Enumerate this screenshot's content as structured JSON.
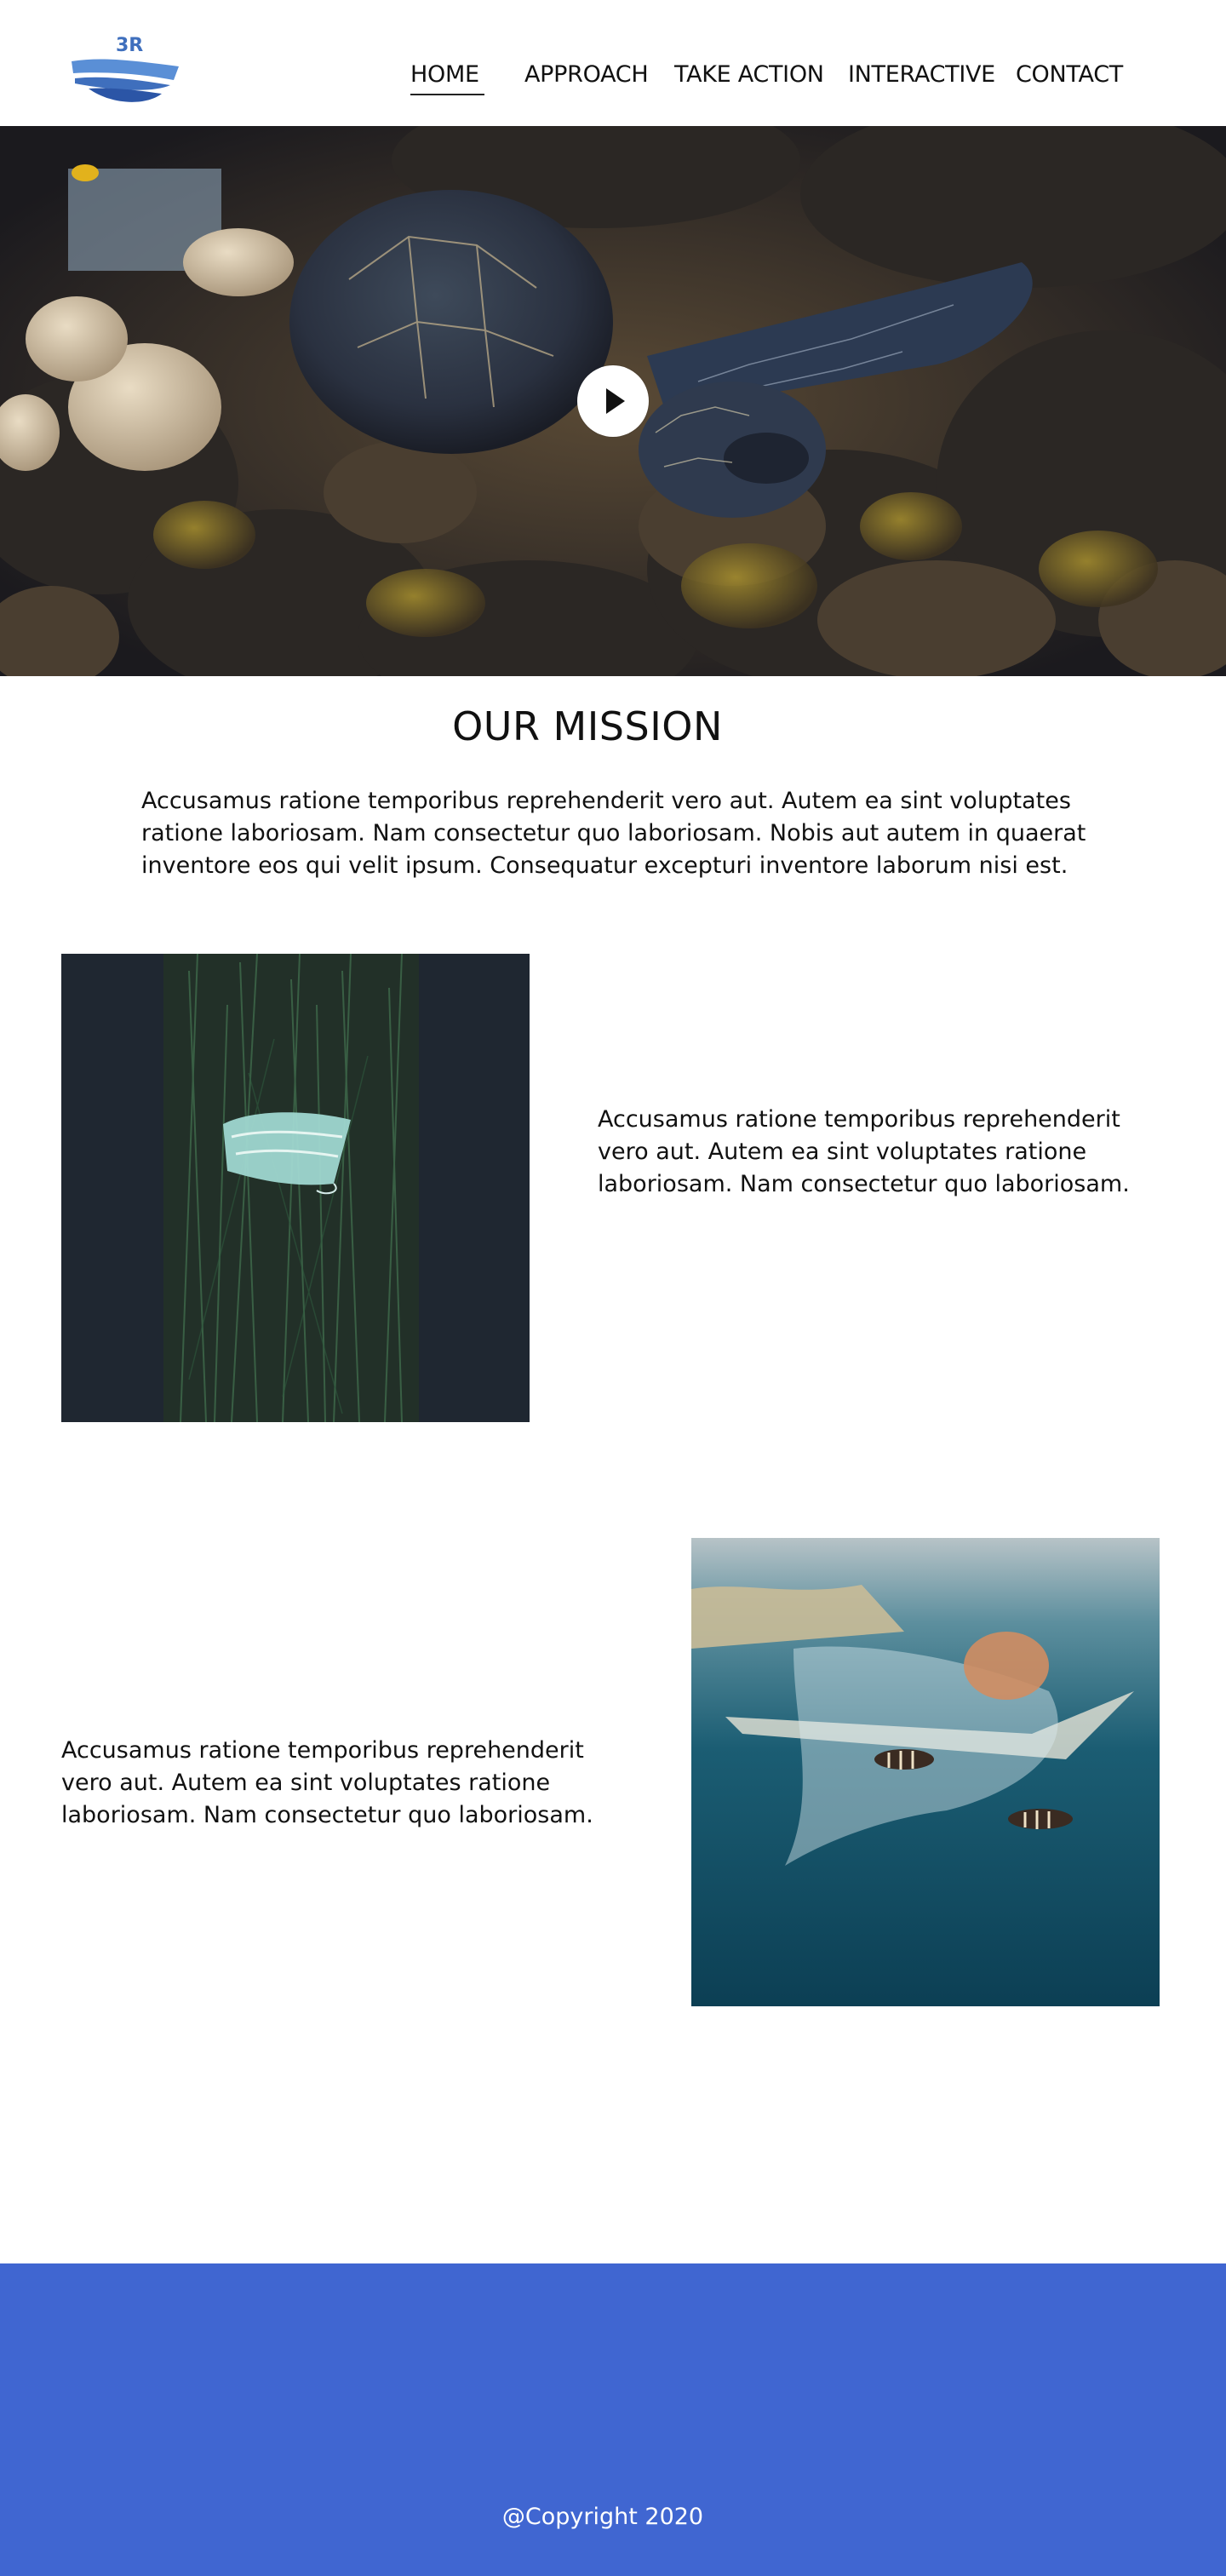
{
  "header": {
    "logo_text": "3R",
    "nav": [
      {
        "label": "HOME",
        "active": true
      },
      {
        "label": "APPROACH",
        "active": false
      },
      {
        "label": "TAKE ACTION",
        "active": false
      },
      {
        "label": "INTERACTIVE",
        "active": false
      },
      {
        "label": "CONTACT",
        "active": false
      }
    ]
  },
  "hero": {
    "image": "sea-turtle-on-reef",
    "play_icon": "play-icon"
  },
  "mission": {
    "title": "OUR MISSION",
    "text": "Accusamus ratione temporibus reprehenderit vero aut. Autem ea sint voluptates ratione laboriosam. Nam consectetur quo laboriosam. Nobis aut autem in quaerat inventore eos qui velit ipsum. Consequatur excepturi inventore laborum nisi est."
  },
  "sections": [
    {
      "image": "face-mask-in-seagrass",
      "text": "Accusamus ratione temporibus reprehenderit vero aut. Autem ea sint voluptates ratione laboriosam. Nam consectetur quo laboriosam."
    },
    {
      "image": "plastic-bag-with-fish",
      "text": "Accusamus ratione temporibus reprehenderit vero aut. Autem ea sint voluptates ratione laboriosam. Nam consectetur quo laboriosam."
    }
  ],
  "footer": {
    "copyright": "@Copyright 2020"
  },
  "colors": {
    "footer_bg": "#4066d1",
    "logo_blue": "#3f6fbd",
    "logo_dark": "#2b55a6"
  }
}
